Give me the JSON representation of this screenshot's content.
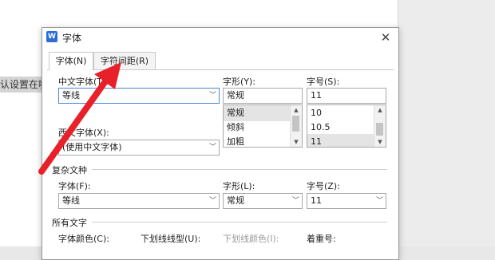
{
  "document": {
    "text": "认设置在哪"
  },
  "dialog": {
    "title": "字体",
    "tabs": [
      {
        "label": "字体(N)",
        "active": true
      },
      {
        "label": "字符间距(R)",
        "active": false
      }
    ],
    "chinese_font": {
      "label": "中文字体(T):",
      "value": "等线"
    },
    "western_font": {
      "label": "西文字体(X):",
      "value": "(使用中文字体)"
    },
    "style": {
      "label": "字形(Y):",
      "value": "常规",
      "options": [
        "常规",
        "倾斜",
        "加粗"
      ],
      "selected": "常规"
    },
    "size": {
      "label": "字号(S):",
      "value": "11",
      "options": [
        "10",
        "10.5",
        "11"
      ],
      "selected": "11"
    },
    "complex_section": {
      "title": "复杂文种",
      "font": {
        "label": "字体(F):",
        "value": "等线"
      },
      "style": {
        "label": "字形(L):",
        "value": "常规"
      },
      "size": {
        "label": "字号(Z):",
        "value": "11"
      }
    },
    "all_text_section": {
      "title": "所有文字",
      "font_color_label": "字体颜色(C):",
      "underline_type_label": "下划线线型(U):",
      "underline_color_label": "下划线颜色(I):",
      "emphasis_label": "着重号:"
    }
  },
  "annotation": {
    "color": "#e8202a"
  }
}
